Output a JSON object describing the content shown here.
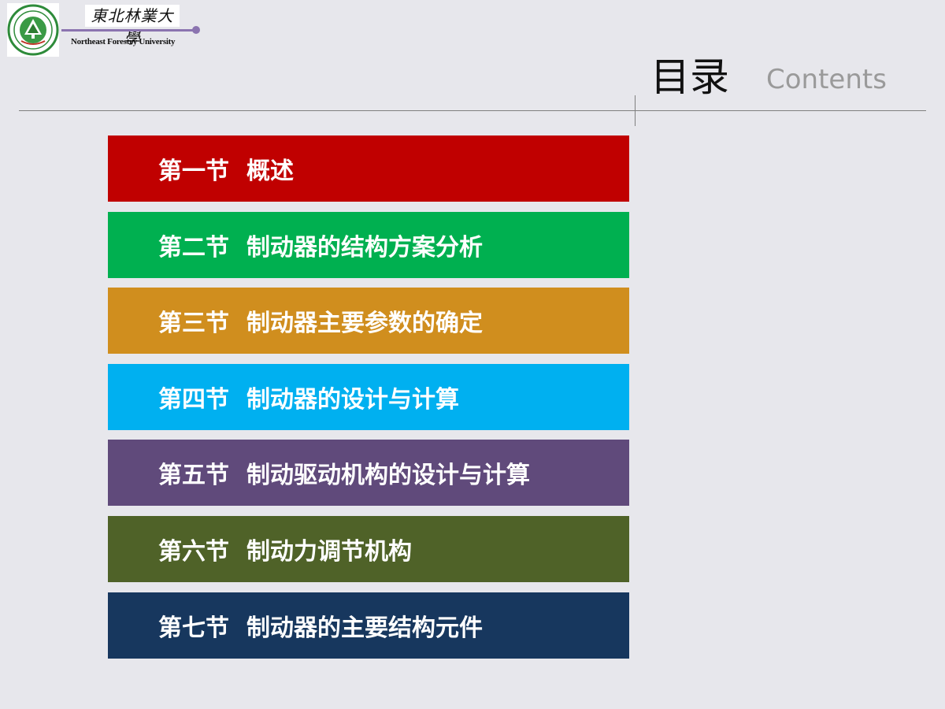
{
  "header": {
    "university_cn": "東北林業大學",
    "university_en": "Northeast Forestry University",
    "title": "目录",
    "subtitle": "Contents",
    "accent_color": "#8b74b0"
  },
  "toc": {
    "items": [
      {
        "num": "第一节",
        "label": "概述",
        "color": "#c00000"
      },
      {
        "num": "第二节",
        "label": "制动器的结构方案分析",
        "color": "#00b050"
      },
      {
        "num": "第三节",
        "label": "制动器主要参数的确定",
        "color": "#d08e1e"
      },
      {
        "num": "第四节",
        "label": "制动器的设计与计算",
        "color": "#00b0f0"
      },
      {
        "num": "第五节",
        "label": "制动驱动机构的设计与计算",
        "color": "#604a7b"
      },
      {
        "num": "第六节",
        "label": "制动力调节机构",
        "color": "#4f6228"
      },
      {
        "num": "第七节",
        "label": "制动器的主要结构元件",
        "color": "#17375e"
      }
    ]
  }
}
